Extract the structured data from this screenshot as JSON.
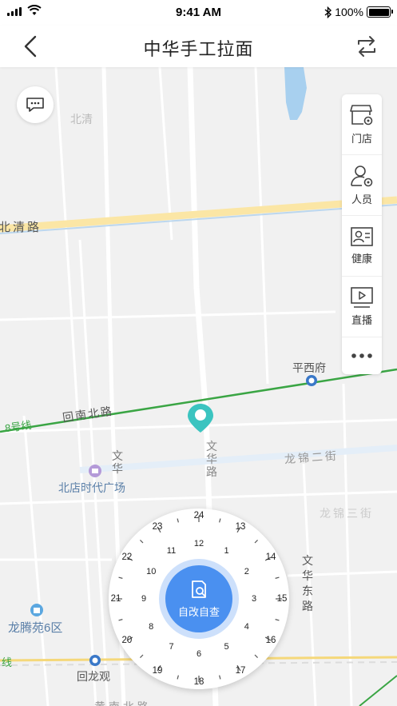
{
  "status_bar": {
    "time": "9:41 AM",
    "battery": "100%"
  },
  "nav": {
    "title": "中华手工拉面"
  },
  "map": {
    "roads": {
      "beiqing": "北清路",
      "huinan_beilu": "回南北路",
      "line8": "8号线",
      "wenhua_lu": "文华路",
      "wenhua": "文华",
      "longjin_erjie": "龙锦二街",
      "longjin_sanjie": "龙锦三街",
      "wenhua_donglu": "文华东路",
      "line_cut": "线",
      "bottom_cut": "黄 南 北 路"
    },
    "places": {
      "pingxifu": "平西府",
      "beidian": "北店时代广场",
      "longteng": "龙腾苑6区",
      "huilongguan": "回龙观",
      "bei_qing_cut": "北清"
    }
  },
  "side_panel": {
    "items": [
      {
        "label": "门店",
        "icon": "store-settings-icon"
      },
      {
        "label": "人员",
        "icon": "user-settings-icon"
      },
      {
        "label": "健康",
        "icon": "id-card-icon"
      },
      {
        "label": "直播",
        "icon": "live-play-icon"
      }
    ],
    "more_icon": "more-dots-icon"
  },
  "dial": {
    "center_label": "自改自查",
    "inner_hours": [
      "12",
      "1",
      "2",
      "3",
      "4",
      "5",
      "6",
      "7",
      "8",
      "9",
      "10",
      "11"
    ],
    "outer_hours": [
      "24",
      "13",
      "14",
      "15",
      "16",
      "17",
      "18",
      "19",
      "20",
      "21",
      "22",
      "23"
    ]
  },
  "colors": {
    "accent": "#4a90f0",
    "pin": "#3bc4c0",
    "metro_green": "#3aa544",
    "road_yellow": "#fbe6a5",
    "water": "#a8d0ef"
  }
}
